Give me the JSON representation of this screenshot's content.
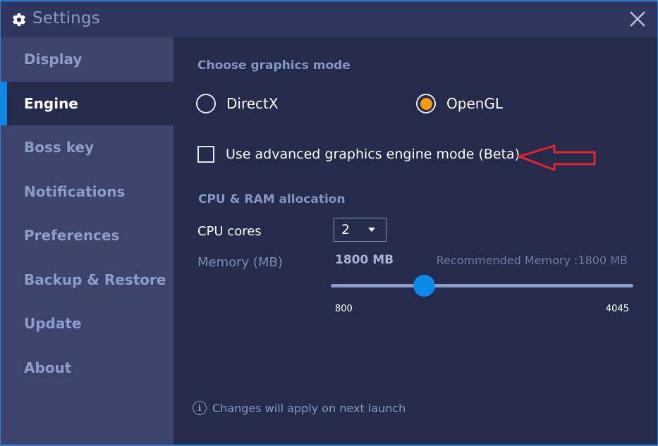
{
  "window": {
    "title": "Settings",
    "title_icon": "gear-icon",
    "close_icon": "close-icon"
  },
  "sidebar": {
    "items": [
      {
        "label": "Display",
        "active": false
      },
      {
        "label": "Engine",
        "active": true
      },
      {
        "label": "Boss key",
        "active": false
      },
      {
        "label": "Notifications",
        "active": false
      },
      {
        "label": "Preferences",
        "active": false
      },
      {
        "label": "Backup & Restore",
        "active": false
      },
      {
        "label": "Update",
        "active": false
      },
      {
        "label": "About",
        "active": false
      }
    ]
  },
  "engine": {
    "graphics_section_title": "Choose graphics mode",
    "graphics_options": [
      {
        "label": "DirectX",
        "selected": false
      },
      {
        "label": "OpenGL",
        "selected": true
      }
    ],
    "advanced_mode": {
      "label": "Use advanced graphics engine mode (Beta)",
      "checked": false
    },
    "allocation_section_title": "CPU & RAM allocation",
    "cpu": {
      "label": "CPU cores",
      "selected_value": "2"
    },
    "memory": {
      "label": "Memory (MB)",
      "current_value_text": "1800 MB",
      "recommended_text": "Recommended Memory :1800 MB",
      "min": 800,
      "max": 4045,
      "value": 1800,
      "min_label": "800",
      "max_label": "4045"
    },
    "info_note": "Changes will apply on next launch"
  },
  "colors": {
    "accent_blue": "#0a8ae8",
    "radio_selected": "#f09a0c",
    "annotation_red": "#e8212b"
  },
  "annotation": {
    "type": "arrow-left",
    "target": "advanced-mode-checkbox"
  }
}
